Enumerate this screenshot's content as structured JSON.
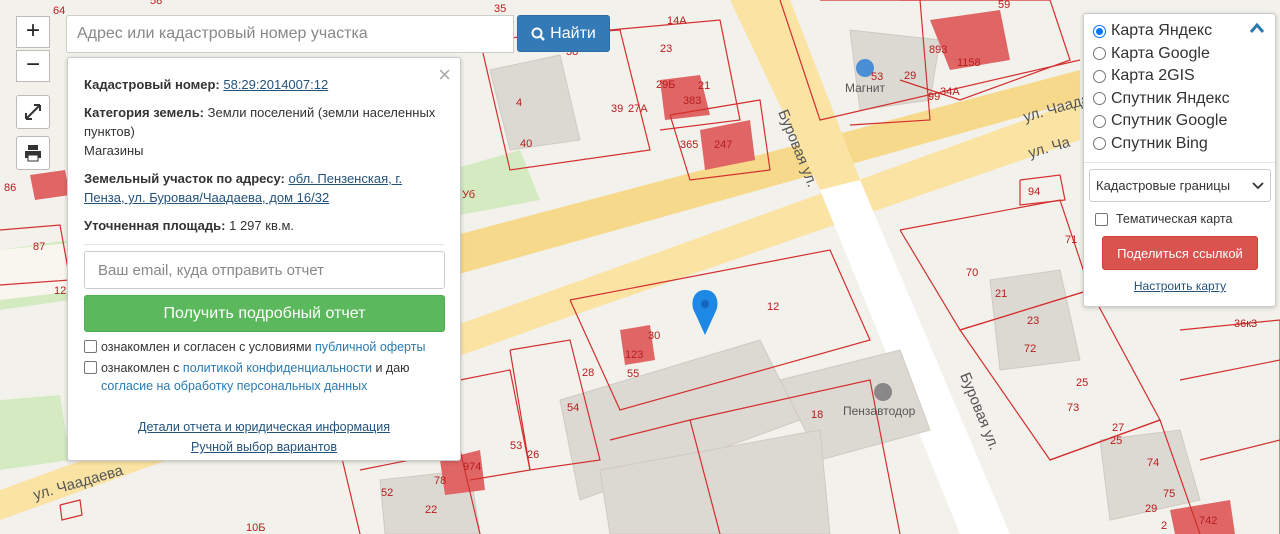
{
  "map": {
    "streets": {
      "chaadaeva_1": "ул. Чаадаева",
      "chaadaeva_2": "ул. Ча",
      "chaadaeva_3": "ул. Чаадаева",
      "burovaya_1": "Буровая ул.",
      "burovaya_2": "Буровая ул."
    },
    "poi": {
      "magnit": "Магнит",
      "penzavtodor": "Пензавтодор"
    },
    "labels": [
      "64",
      "58",
      "38",
      "35",
      "59",
      "14А",
      "23",
      "893",
      "1158",
      "29Б",
      "53",
      "29",
      "99",
      "34А",
      "4",
      "39",
      "27А",
      "383",
      "21",
      "40",
      "365",
      "247",
      "86",
      "87",
      "94",
      "71",
      "12",
      "12",
      "30",
      "123",
      "55",
      "28",
      "70",
      "21",
      "23",
      "72",
      "54",
      "53",
      "26",
      "18",
      "974",
      "78",
      "52",
      "22",
      "10Б",
      "25",
      "73",
      "27",
      "25",
      "74",
      "75",
      "29",
      "2",
      "742",
      "36к3",
      "Уб"
    ]
  },
  "controls": {
    "zoom_in": "+",
    "zoom_out": "−"
  },
  "search": {
    "placeholder": "Адрес или кадастровый номер участка",
    "button_label": "Найти"
  },
  "info": {
    "close": "×",
    "cadastral_label": "Кадастровый номер:",
    "cadastral_value": "58:29:2014007:12",
    "category_label": "Категория земель:",
    "category_value": "Земли поселений (земли населенных пунктов)",
    "usage": "Магазины",
    "address_label": "Земельный участок по адресу:",
    "address_value": "обл. Пензенская, г. Пенза, ул. Буровая/Чаадаева, дом 16/32",
    "area_label": "Уточненная площадь:",
    "area_value": "1 297 кв.м.",
    "email_placeholder": "Ваш email, куда отправить отчет",
    "report_button": "Получить подробный отчет",
    "consent1_text": "ознакомлен и согласен с условиями",
    "consent1_link": "публичной оферты",
    "consent2_text_a": "ознакомлен с",
    "consent2_link_a": "политикой конфиденциальности",
    "consent2_text_b": "и даю",
    "consent2_link_b": "согласие на обработку персональных данных",
    "details_link": "Детали отчета и юридическая информация",
    "manual_link": "Ручной выбор вариантов"
  },
  "layers": {
    "options": [
      "Карта Яндекс",
      "Карта Google",
      "Карта 2GIS",
      "Спутник Яндекс",
      "Спутник Google",
      "Спутник Bing"
    ],
    "selected_index": 0,
    "boundaries_select": "Кадастровые границы",
    "thematic_label": "Тематическая карта",
    "share_button": "Поделиться ссылкой",
    "configure_link": "Настроить карту"
  },
  "colors": {
    "primary": "#337ab7",
    "success": "#5cb85c",
    "danger": "#d9534f",
    "boundary": "#d32f2f",
    "road": "#f7d98b",
    "marker": "#1e88e5"
  }
}
